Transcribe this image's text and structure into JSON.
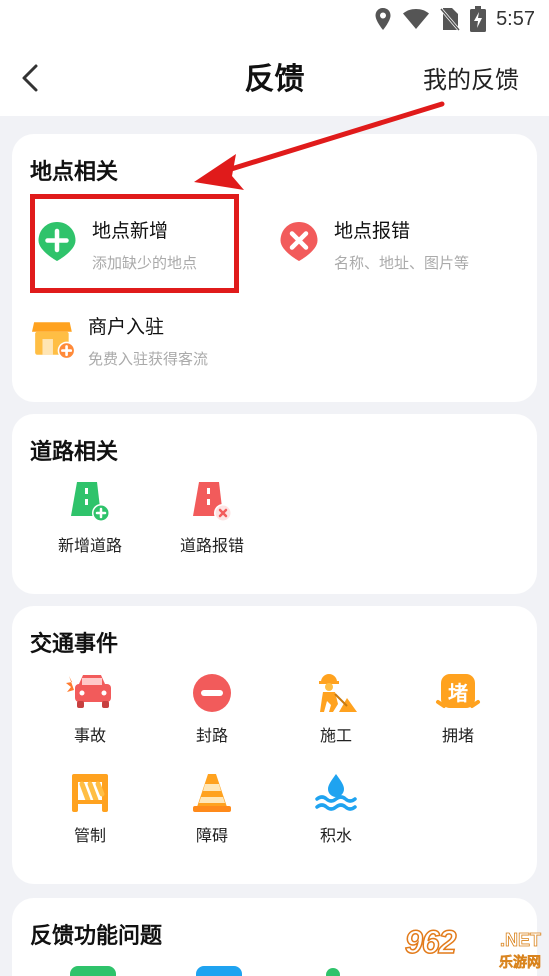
{
  "status_bar": {
    "time": "5:57"
  },
  "nav": {
    "title": "反馈",
    "right_label": "我的反馈"
  },
  "place_section": {
    "title": "地点相关",
    "items": [
      {
        "title": "地点新增",
        "subtitle": "添加缺少的地点"
      },
      {
        "title": "地点报错",
        "subtitle": "名称、地址、图片等"
      },
      {
        "title": "商户入驻",
        "subtitle": "免费入驻获得客流"
      }
    ]
  },
  "road_section": {
    "title": "道路相关",
    "items": [
      {
        "label": "新增道路"
      },
      {
        "label": "道路报错"
      }
    ]
  },
  "traffic_section": {
    "title": "交通事件",
    "items": [
      {
        "label": "事故"
      },
      {
        "label": "封路"
      },
      {
        "label": "施工"
      },
      {
        "label": "拥堵",
        "icon_text": "堵"
      },
      {
        "label": "管制"
      },
      {
        "label": "障碍"
      },
      {
        "label": "积水"
      }
    ]
  },
  "feature_section": {
    "title": "反馈功能问题"
  },
  "watermark": {
    "number": "962",
    "suffix": ".NET",
    "subtitle": "乐游网"
  },
  "colors": {
    "accent_red": "#e01b1b",
    "green": "#2fc36b",
    "red_icon": "#f25b5b",
    "orange": "#ffa21f",
    "blue": "#1fa3f0"
  }
}
